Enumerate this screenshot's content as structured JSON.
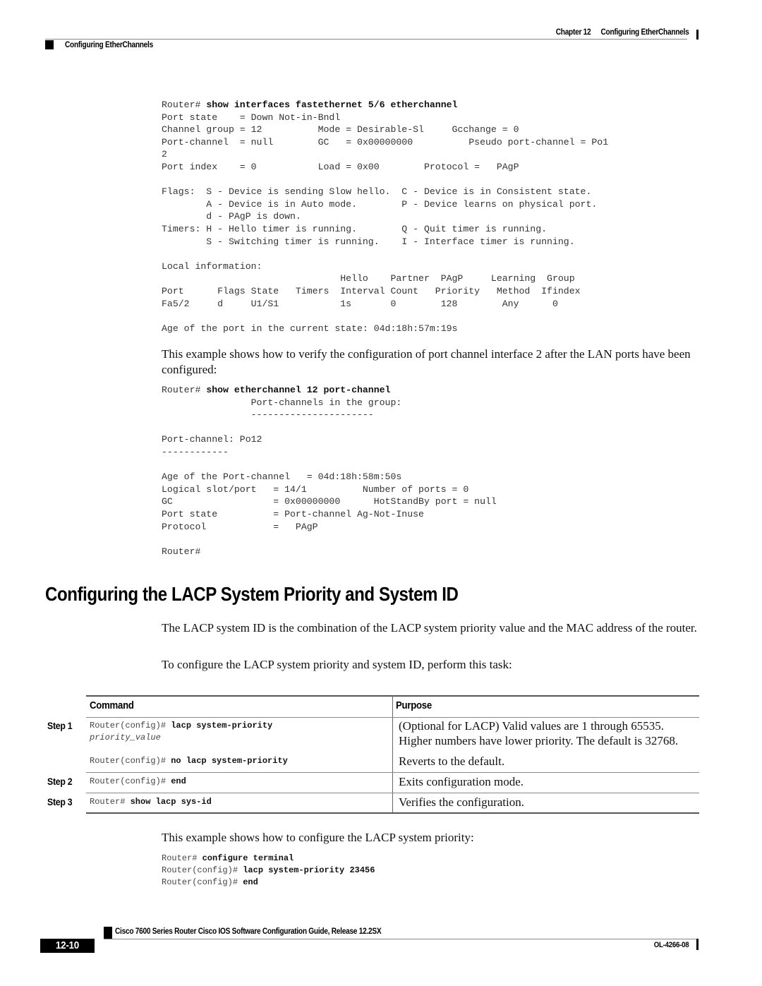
{
  "header": {
    "chapter_label": "Chapter 12",
    "chapter_title": "Configuring EtherChannels",
    "section_title": "Configuring EtherChannels"
  },
  "example1": {
    "prompt": "Router# ",
    "command": "show interfaces fastethernet 5/6 etherchannel",
    "output": [
      "Port state    = Down Not-in-Bndl",
      "Channel group = 12          Mode = Desirable-Sl     Gcchange = 0",
      "Port-channel  = null        GC   = 0x00000000          Pseudo port-channel = Po1",
      "2",
      "Port index    = 0           Load = 0x00        Protocol =   PAgP",
      "",
      "Flags:  S - Device is sending Slow hello.  C - Device is in Consistent state.",
      "        A - Device is in Auto mode.        P - Device learns on physical port.",
      "        d - PAgP is down.",
      "Timers: H - Hello timer is running.        Q - Quit timer is running.",
      "        S - Switching timer is running.    I - Interface timer is running.",
      "",
      "Local information:",
      "                                Hello    Partner  PAgP     Learning  Group",
      "Port      Flags State   Timers  Interval Count   Priority   Method  Ifindex",
      "Fa5/2     d     U1/S1           1s       0        128        Any      0",
      "",
      "Age of the port in the current state: 04d:18h:57m:19s"
    ]
  },
  "para1": "This example shows how to verify the configuration of port channel interface 2 after the LAN ports have been configured:",
  "example2": {
    "prompt": "Router# ",
    "command": "show etherchannel 12 port-channel",
    "output": [
      "                Port-channels in the group:",
      "                ----------------------",
      "",
      "Port-channel: Po12",
      "------------",
      "",
      "Age of the Port-channel   = 04d:18h:58m:50s",
      "Logical slot/port   = 14/1          Number of ports = 0",
      "GC                  = 0x00000000      HotStandBy port = null",
      "Port state          = Port-channel Ag-Not-Inuse",
      "Protocol            =   PAgP",
      "",
      "Router#"
    ]
  },
  "section": {
    "heading": "Configuring the LACP System Priority and System ID",
    "intro1": "The LACP system ID is the combination of the LACP system priority value and the MAC address of the router.",
    "intro2": "To configure the LACP system priority and system ID, perform this task:"
  },
  "task_table": {
    "col_command": "Command",
    "col_purpose": "Purpose",
    "rows": [
      {
        "step": "Step 1",
        "prompt": "Router(config)# ",
        "command": "lacp system-priority",
        "argument": "priority_value",
        "purpose_lines": [
          "(Optional for LACP) Valid values are 1 through 65535.",
          "Higher numbers have lower priority. The default is 32768."
        ]
      },
      {
        "step": "",
        "prompt": "Router(config)# ",
        "command": "no lacp system-priority",
        "purpose_lines": [
          "Reverts to the default."
        ]
      },
      {
        "step": "Step 2",
        "prompt": "Router(config)# ",
        "command": "end",
        "purpose_lines": [
          "Exits configuration mode."
        ]
      },
      {
        "step": "Step 3",
        "prompt": "Router# ",
        "command": "show lacp sys-id",
        "purpose_lines": [
          "Verifies the configuration."
        ]
      }
    ]
  },
  "para2": "This example shows how to configure the LACP system priority:",
  "example3": {
    "lines": [
      {
        "prompt": "Router# ",
        "command": "configure terminal"
      },
      {
        "prompt": "Router(config)# ",
        "command": "lacp system-priority 23456"
      },
      {
        "prompt": "Router(config)# ",
        "command": "end"
      }
    ]
  },
  "footer": {
    "doc_title": "Cisco 7600 Series Router Cisco IOS Software Configuration Guide, Release 12.2SX",
    "page_number": "12-10",
    "doc_id": "OL-4266-08"
  }
}
